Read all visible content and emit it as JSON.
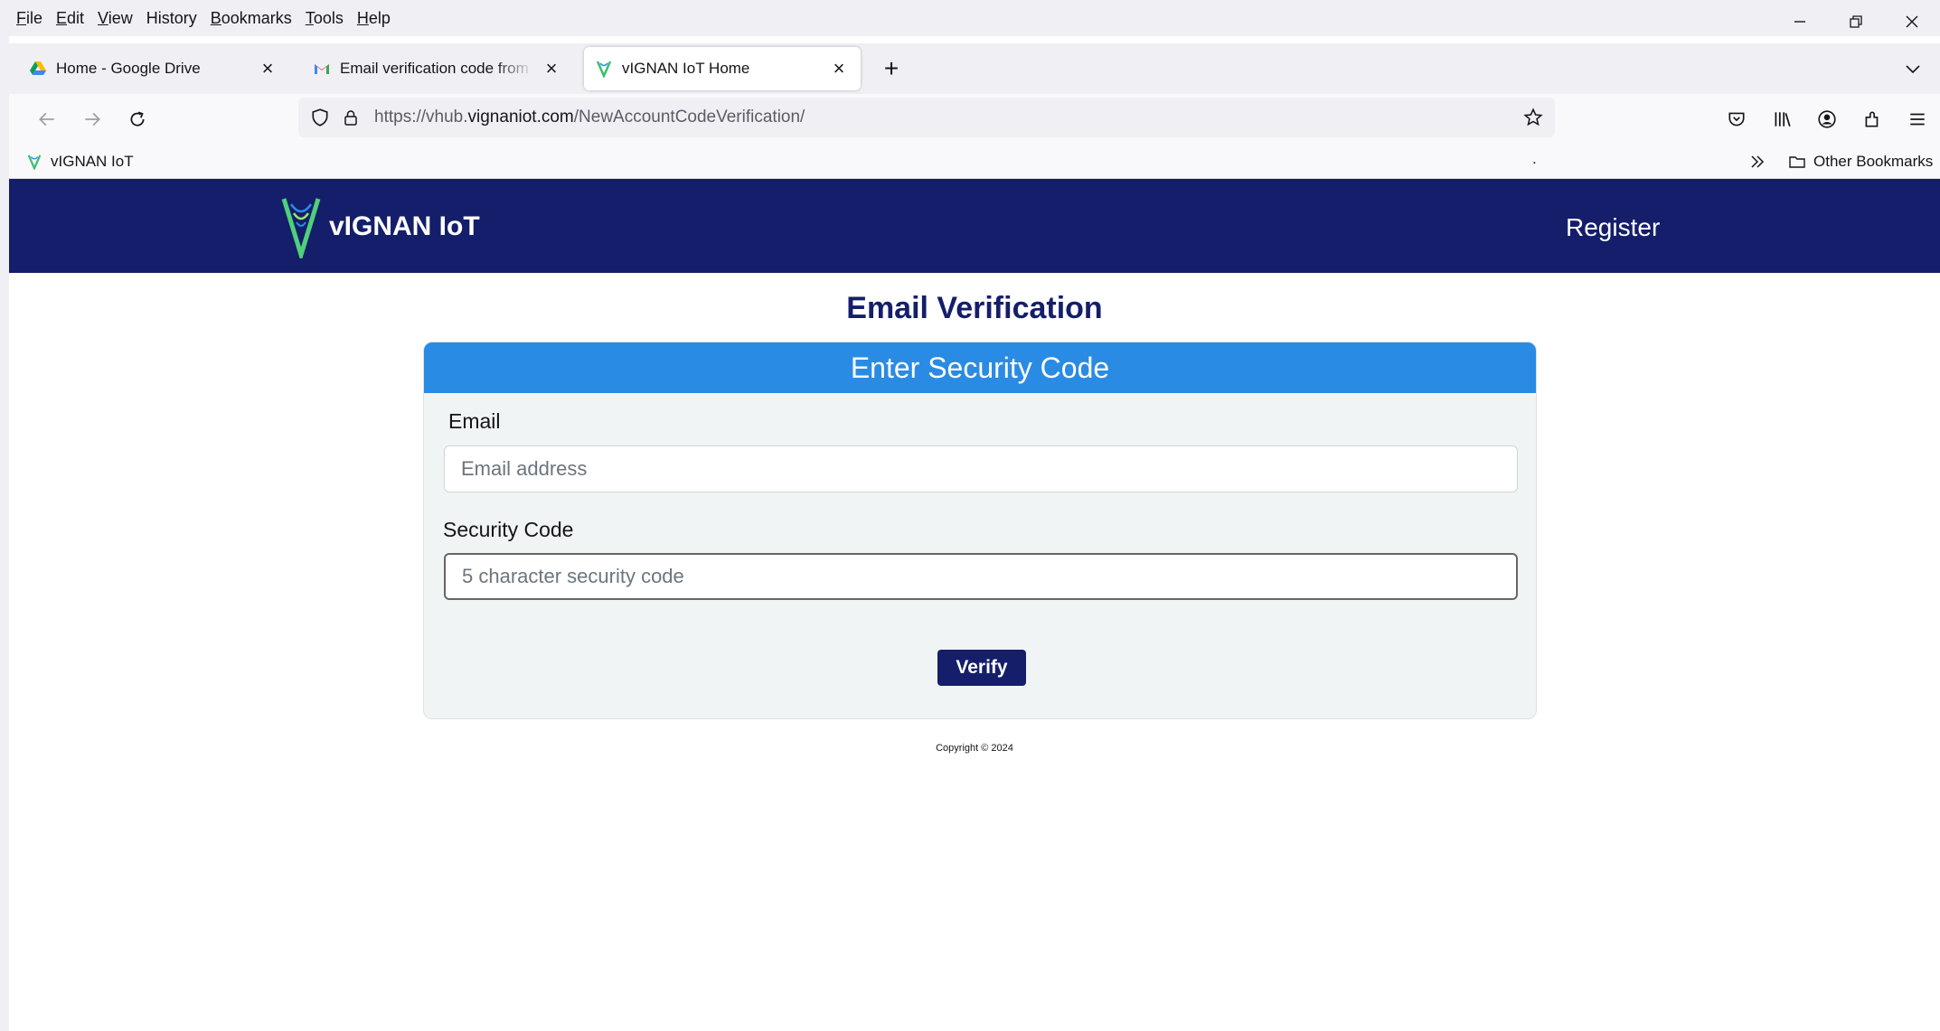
{
  "menubar": {
    "items": [
      {
        "label": "File",
        "accel": "F",
        "rest": "ile"
      },
      {
        "label": "Edit",
        "accel": "E",
        "rest": "dit"
      },
      {
        "label": "View",
        "accel": "V",
        "rest": "iew"
      },
      {
        "label": "History",
        "accel": "",
        "rest": "History"
      },
      {
        "label": "Bookmarks",
        "accel": "B",
        "rest": "ookmarks"
      },
      {
        "label": "Tools",
        "accel": "T",
        "rest": "ools"
      },
      {
        "label": "Help",
        "accel": "H",
        "rest": "elp"
      }
    ]
  },
  "tabs": [
    {
      "title": "Home - Google Drive",
      "icon": "google-drive-icon",
      "active": false
    },
    {
      "title": "Email verification code from VIGNAN IoT",
      "icon": "gmail-icon",
      "active": false
    },
    {
      "title": "vIGNAN IoT Home",
      "icon": "vignan-icon",
      "active": true
    }
  ],
  "urlbar": {
    "prefix": "https://vhub.",
    "domain": "vignaniot.com",
    "path": "/NewAccountCodeVerification/"
  },
  "bookmarks": {
    "items": [
      {
        "label": "vIGNAN IoT"
      }
    ],
    "dot": ".",
    "other": "Other Bookmarks"
  },
  "site": {
    "name": "vIGNAN IoT",
    "nav_register": "Register"
  },
  "page": {
    "title": "Email Verification",
    "card_header": "Enter Security Code",
    "email_label": "Email",
    "email_placeholder": "Email address",
    "code_label": "Security Code",
    "code_placeholder": "5 character security code",
    "verify_label": "Verify",
    "footer": "Copyright © 2024"
  },
  "colors": {
    "header_bg": "#141e6a",
    "card_header_bg": "#2a8be4",
    "title_color": "#141e6a",
    "logo_green": "#4fd07a"
  }
}
